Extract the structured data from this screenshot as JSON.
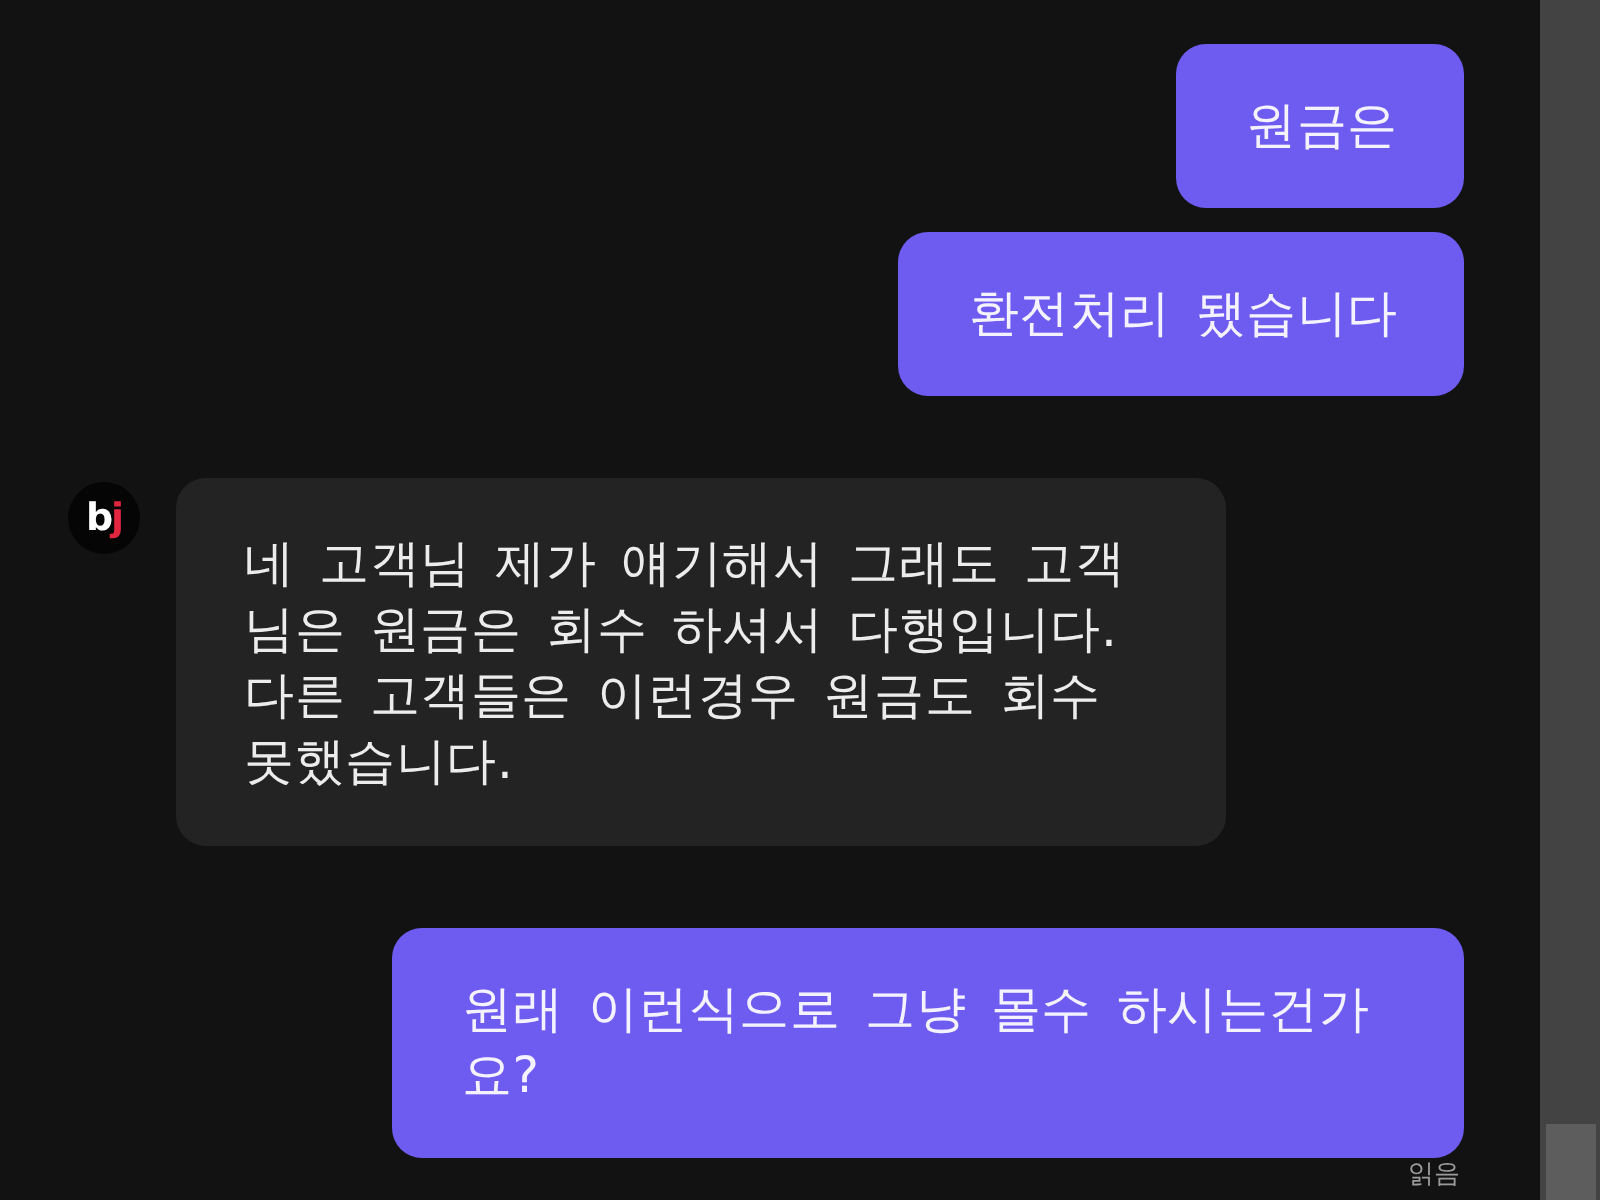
{
  "messages": [
    {
      "kind": "outgoing",
      "text": "원금은"
    },
    {
      "kind": "outgoing",
      "text": "환전처리 됐습니다"
    },
    {
      "kind": "incoming",
      "avatar": "bj",
      "text": "네 고객님 제가 얘기해서 그래도 고객님은 원금은 회수 하셔서 다행입니다. 다른 고객들은 이런경우 원금도 회수 못했습니다."
    },
    {
      "kind": "outgoing",
      "text": "원래 이런식으로 그냥 몰수 하시는건가요?"
    }
  ],
  "read_receipt": "읽음"
}
